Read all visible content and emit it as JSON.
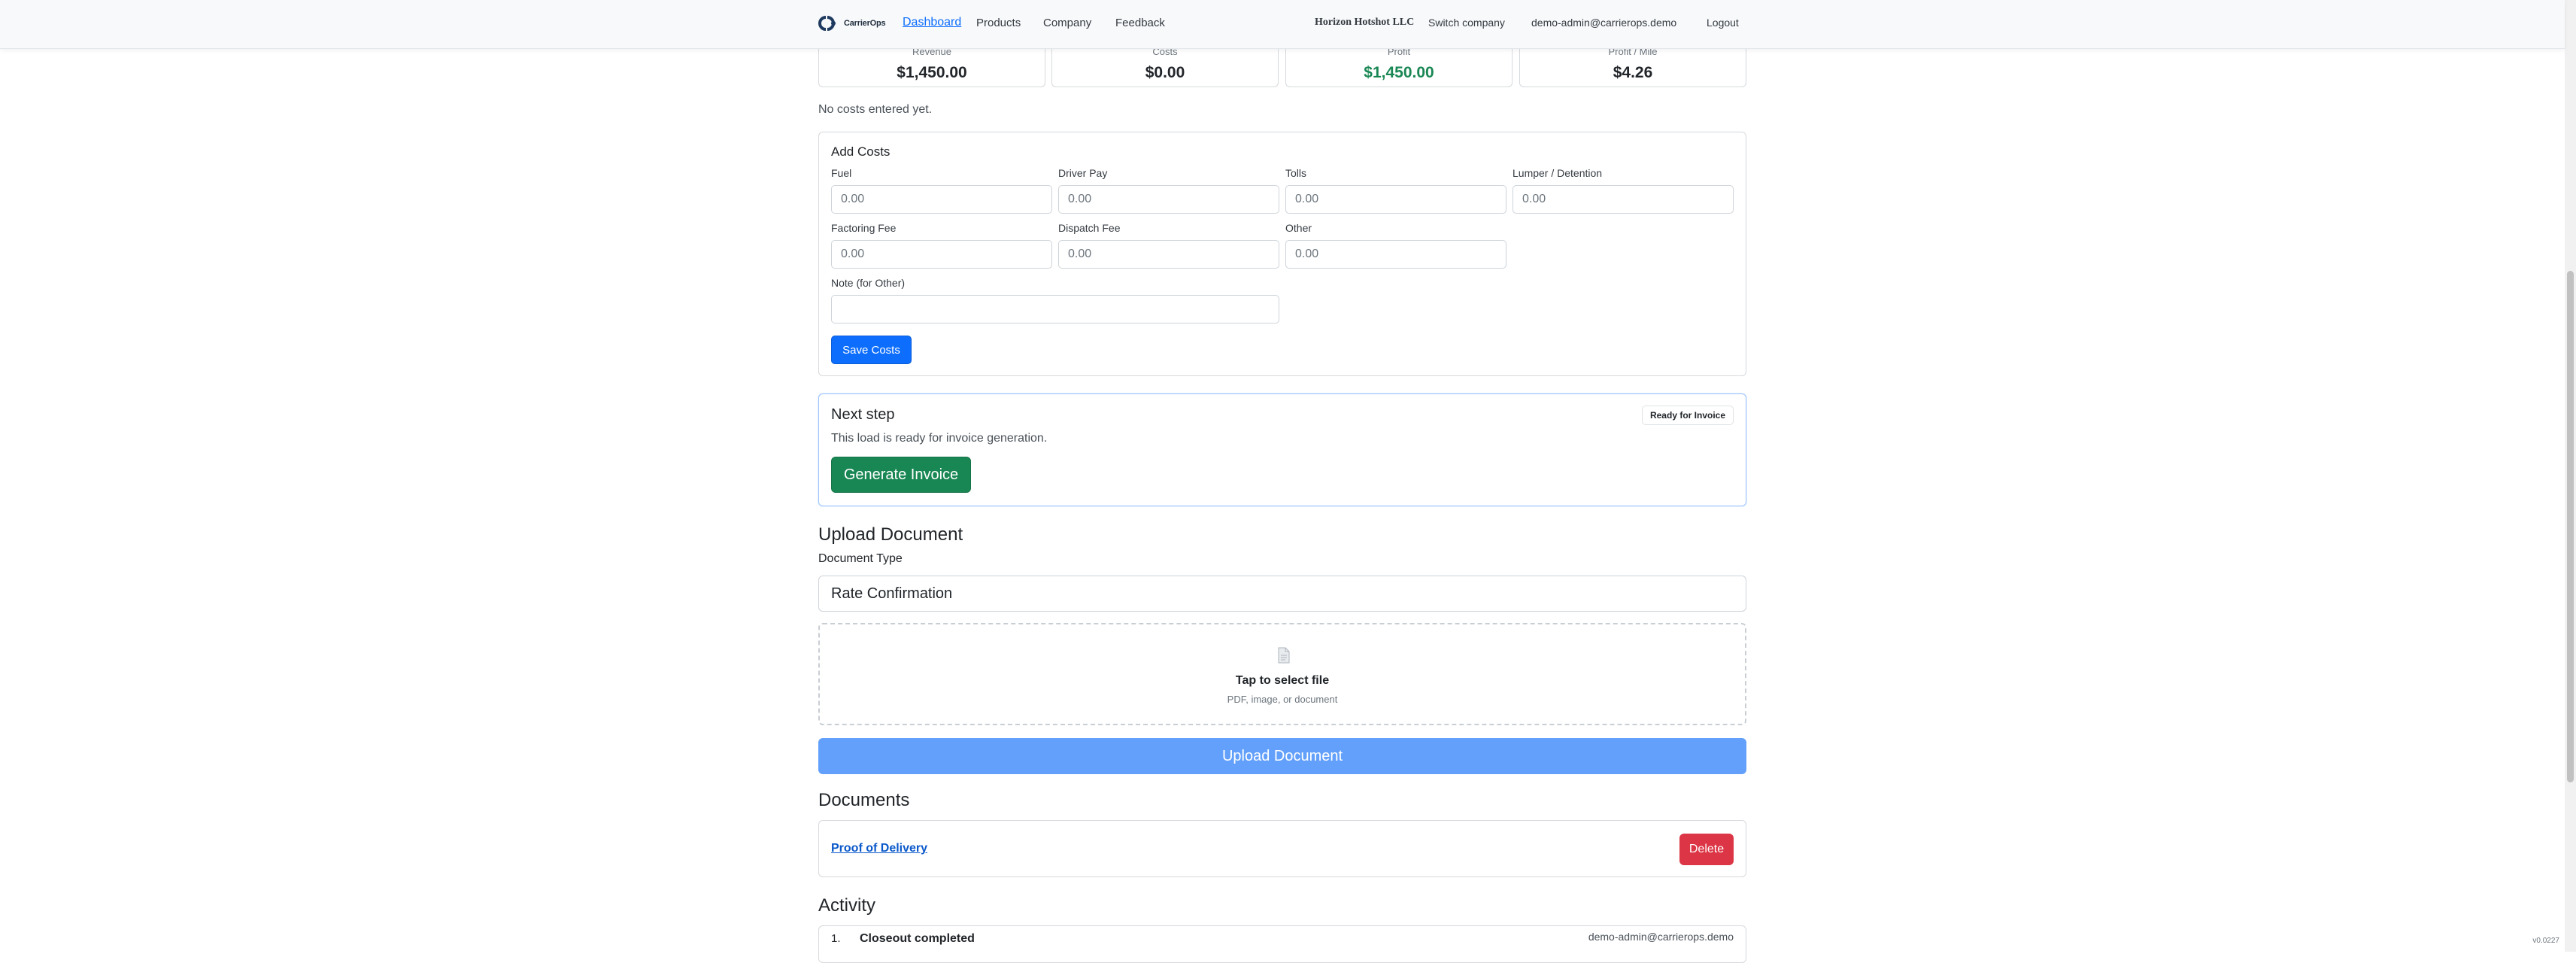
{
  "nav": {
    "brand": "CarrierOps",
    "links": [
      "Dashboard",
      "Products",
      "Company",
      "Feedback"
    ],
    "company": "Horizon Hotshot LLC",
    "switch_company": "Switch company",
    "user_email": "demo-admin@carrierops.demo",
    "logout": "Logout"
  },
  "stats": [
    {
      "label": "Revenue",
      "value": "$1,450.00"
    },
    {
      "label": "Costs",
      "value": "$0.00"
    },
    {
      "label": "Profit",
      "value": "$1,450.00"
    },
    {
      "label": "Profit / Mile",
      "value": "$4.26"
    }
  ],
  "no_costs_text": "No costs entered yet.",
  "add_costs": {
    "title": "Add Costs",
    "fields": [
      {
        "label": "Fuel",
        "placeholder": "0.00"
      },
      {
        "label": "Driver Pay",
        "placeholder": "0.00"
      },
      {
        "label": "Tolls",
        "placeholder": "0.00"
      },
      {
        "label": "Lumper / Detention",
        "placeholder": "0.00"
      },
      {
        "label": "Factoring Fee",
        "placeholder": "0.00"
      },
      {
        "label": "Dispatch Fee",
        "placeholder": "0.00"
      },
      {
        "label": "Other",
        "placeholder": "0.00"
      }
    ],
    "note_label": "Note (for Other)",
    "note_value": "",
    "save_label": "Save Costs"
  },
  "next_step": {
    "title": "Next step",
    "badge": "Ready for Invoice",
    "text": "This load is ready for invoice generation.",
    "button": "Generate Invoice"
  },
  "upload": {
    "heading": "Upload Document",
    "type_label": "Document Type",
    "type_value": "Rate Confirmation",
    "drop_title": "Tap to select file",
    "drop_sub": "PDF, image, or document",
    "button": "Upload Document"
  },
  "documents": {
    "heading": "Documents",
    "items": [
      {
        "name": "Proof of Delivery",
        "delete_label": "Delete"
      }
    ]
  },
  "activity": {
    "heading": "Activity",
    "items": [
      {
        "index": "1.",
        "title": "Closeout completed",
        "user": "demo-admin@carrierops.demo"
      }
    ]
  },
  "version": "v0.0227",
  "colors": {
    "primary": "#0d6efd",
    "success": "#198754",
    "danger": "#dc3545",
    "upload": "#62a0fb"
  }
}
